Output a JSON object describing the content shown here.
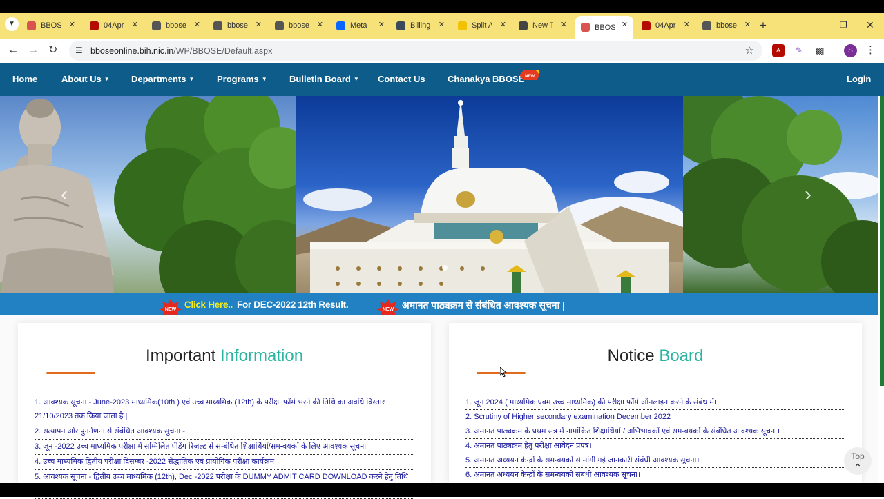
{
  "browser": {
    "tabs": [
      {
        "title": "BBOSE",
        "favicon": "bbose-logo-icon",
        "color": "#d9534f",
        "active": false
      },
      {
        "title": "04Apr",
        "favicon": "pdf-icon",
        "color": "#b30b00",
        "active": false
      },
      {
        "title": "bbose",
        "favicon": "globe-icon",
        "color": "#555555",
        "active": false
      },
      {
        "title": "bbose",
        "favicon": "globe-icon",
        "color": "#555555",
        "active": false
      },
      {
        "title": "bbose",
        "favicon": "globe-icon",
        "color": "#555555",
        "active": false
      },
      {
        "title": "Meta",
        "favicon": "meta-icon",
        "color": "#0866ff",
        "active": false
      },
      {
        "title": "Billing",
        "favicon": "billing-icon",
        "color": "#3b4a5a",
        "active": false
      },
      {
        "title": "Split A",
        "favicon": "split-icon",
        "color": "#f2c200",
        "active": false
      },
      {
        "title": "New T",
        "favicon": "chrome-icon",
        "color": "#444444",
        "active": false
      },
      {
        "title": "BBOSE",
        "favicon": "bbose-logo-icon",
        "color": "#d9534f",
        "active": true
      },
      {
        "title": "04Apr",
        "favicon": "pdf-icon",
        "color": "#b30b00",
        "active": false
      },
      {
        "title": "bbose",
        "favicon": "globe-icon",
        "color": "#555555",
        "active": false
      }
    ],
    "url_host": "bboseonline.bih.nic.in",
    "url_path": "/WP/BBOSE/Default.aspx",
    "profile_initial": "S"
  },
  "nav": {
    "home": "Home",
    "about": "About Us",
    "departments": "Departments",
    "programs": "Programs",
    "bulletin": "Bulletin Board",
    "contact": "Contact Us",
    "chanakya": "Chanakya BBOSE",
    "login": "Login"
  },
  "badge_new": "NEW",
  "marquee": {
    "link": "Click Here..",
    "text1": "For DEC-2022 12th Result.",
    "text2": "अमानत पाठ्यक्रम से संबंधित आवश्यक सूचना |"
  },
  "important": {
    "title_main": "Important",
    "title_accent": "Information",
    "items": [
      "1. आवश्यक सूचना - June-2023 माध्यमिक(10th ) एवं उच्च माध्यमिक (12th) के परीक्षा फॉर्म भरने की तिथि का अवधि विस्तार 21/10/2023 तक किया जाता है |",
      "2. सत्यापन ओर पुनर्गणना से संबंधित आवश्यक सुचना -",
      "3. जून -2022 उच्च माध्यमिक परीक्षा में सम्मिलित पेंडिंग रिजल्ट से सम्बंधित शिक्षार्थियों/समन्वयकों के लिए आवश्यक सूचना |",
      "4. उच्च माध्यमिक द्वितीय परीक्षा दिसम्बर -2022 सेद्धांतिक एवं प्रायोगिक परीक्षा कार्यक्रम",
      "5. आवश्यक सूचना - द्वितीय उच्च माध्यमिक (12th), Dec -2022 परीक्षा के DUMMY ADMIT CARD DOWNLOAD करने हेतु तिथि का"
    ]
  },
  "notice": {
    "title_main": "Notice",
    "title_accent": "Board",
    "items": [
      "1. जून 2024 ( माध्यमिक एवम उच्च माध्यमिक) की परीक्षा फॉर्म ऑनलाइन करने के संबंध में।",
      "2. Scrutiny of Higher secondary examination December 2022",
      "3. अमानत पाठ्यक्रम के प्रथम सत्र में नामांकित शिक्षार्थियों / अभिभावकों एवं समन्वयकों के संबंधित आवश्यक सूचना।",
      "4. अमानत पाठ्यक्रम हेतु परीक्षा आवेदन प्रपत्र।",
      "5. अमानत अध्ययन केन्द्रों के समन्वयकों से मांगी गई जानकारी संबंधी आवश्यक सूचना।",
      "6. अमानत अध्ययन केन्द्रों के समन्वयकों संबंधी आवश्यक सूचना।"
    ]
  },
  "top_button": "Top",
  "colors": {
    "nav_bg": "#0e5c8a",
    "marquee_bg": "#2181c2",
    "accent_teal": "#2bb4a0",
    "underline_orange": "#e26a1c",
    "link_blue": "#16169a",
    "marquee_yellow": "#f2ee1f"
  }
}
